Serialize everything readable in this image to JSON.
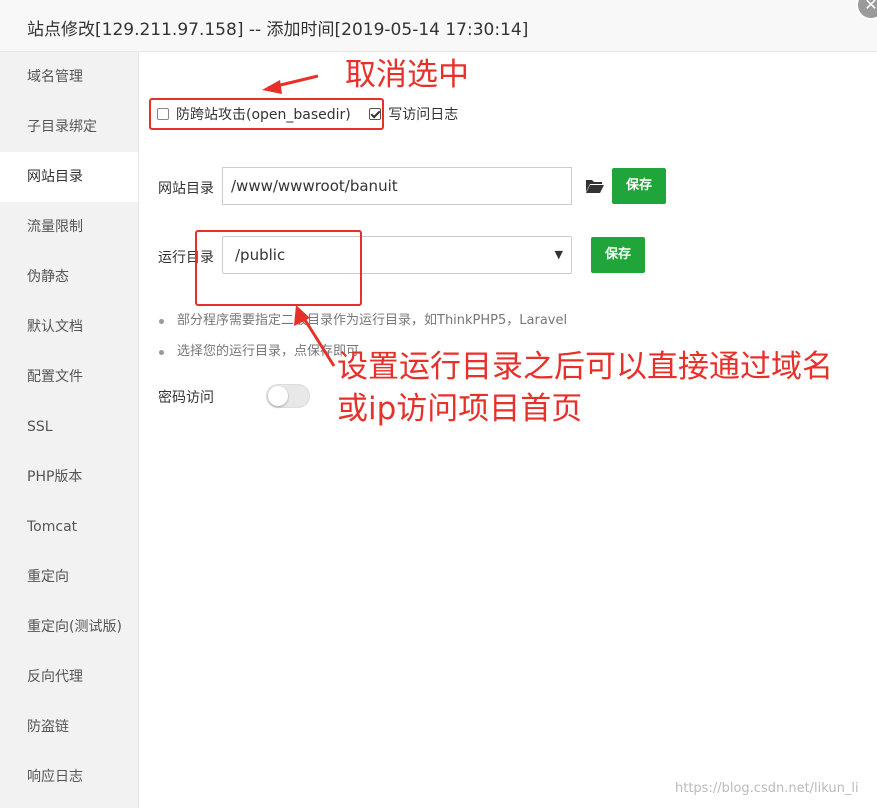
{
  "window": {
    "title": "站点修改[129.211.97.158] -- 添加时间[2019-05-14 17:30:14]",
    "close_glyph": "✕"
  },
  "sidebar": {
    "items": [
      {
        "label": "域名管理"
      },
      {
        "label": "子目录绑定"
      },
      {
        "label": "网站目录",
        "active": true
      },
      {
        "label": "流量限制"
      },
      {
        "label": "伪静态"
      },
      {
        "label": "默认文档"
      },
      {
        "label": "配置文件"
      },
      {
        "label": "SSL"
      },
      {
        "label": "PHP版本"
      },
      {
        "label": "Tomcat"
      },
      {
        "label": "重定向"
      },
      {
        "label": "重定向(测试版)"
      },
      {
        "label": "反向代理"
      },
      {
        "label": "防盗链"
      },
      {
        "label": "响应日志"
      }
    ]
  },
  "options": {
    "anti_xss_label": "防跨站攻击(open_basedir)",
    "anti_xss_checked": false,
    "access_log_label": "写访问日志",
    "access_log_checked": true
  },
  "site_dir": {
    "label": "网站目录",
    "value": "/www/wwwroot/banuit",
    "folder_icon": "folder-open-icon",
    "save_label": "保存"
  },
  "run_dir": {
    "label": "运行目录",
    "value": "/public",
    "save_label": "保存"
  },
  "tips": [
    "部分程序需要指定二级目录作为运行目录，如ThinkPHP5，Laravel",
    "选择您的运行目录，点保存即可"
  ],
  "password_access": {
    "label": "密码访问",
    "enabled": false
  },
  "annotations": {
    "uncheck_note": "取消选中",
    "run_dir_note_line1": "设置运行目录之后可以直接通过域名",
    "run_dir_note_line2": "或ip访问项目首页",
    "color": "#e8302a"
  },
  "watermark": "https://blog.csdn.net/likun_li",
  "colors": {
    "save_button": "#20a53a",
    "sidebar_bg": "#f2f2f2",
    "annotation": "#e8302a"
  }
}
